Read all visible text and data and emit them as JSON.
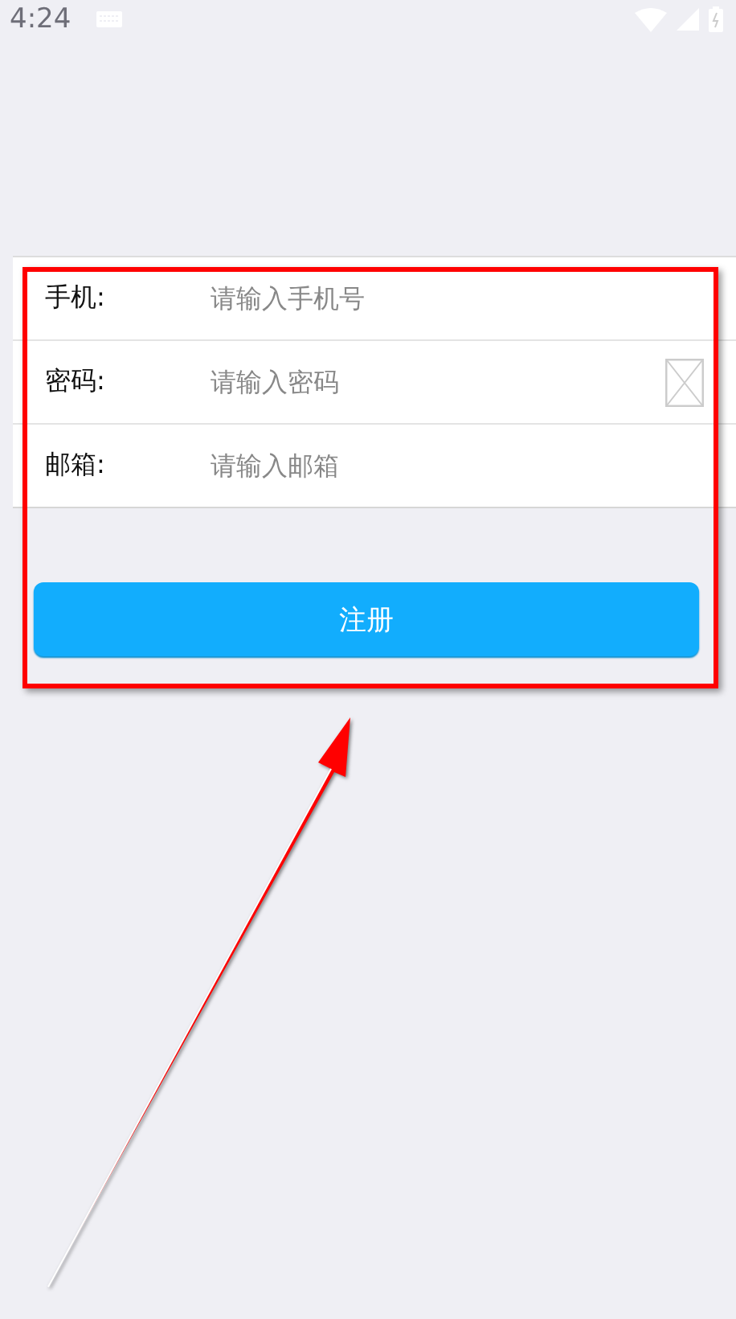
{
  "status_bar": {
    "time": "4:24"
  },
  "form": {
    "fields": [
      {
        "label": "手机:",
        "placeholder": "请输入手机号",
        "kind": "text"
      },
      {
        "label": "密码:",
        "placeholder": "请输入密码",
        "kind": "password"
      },
      {
        "label": "邮箱:",
        "placeholder": "请输入邮箱",
        "kind": "text"
      }
    ]
  },
  "submit_button": {
    "label": "注册"
  }
}
